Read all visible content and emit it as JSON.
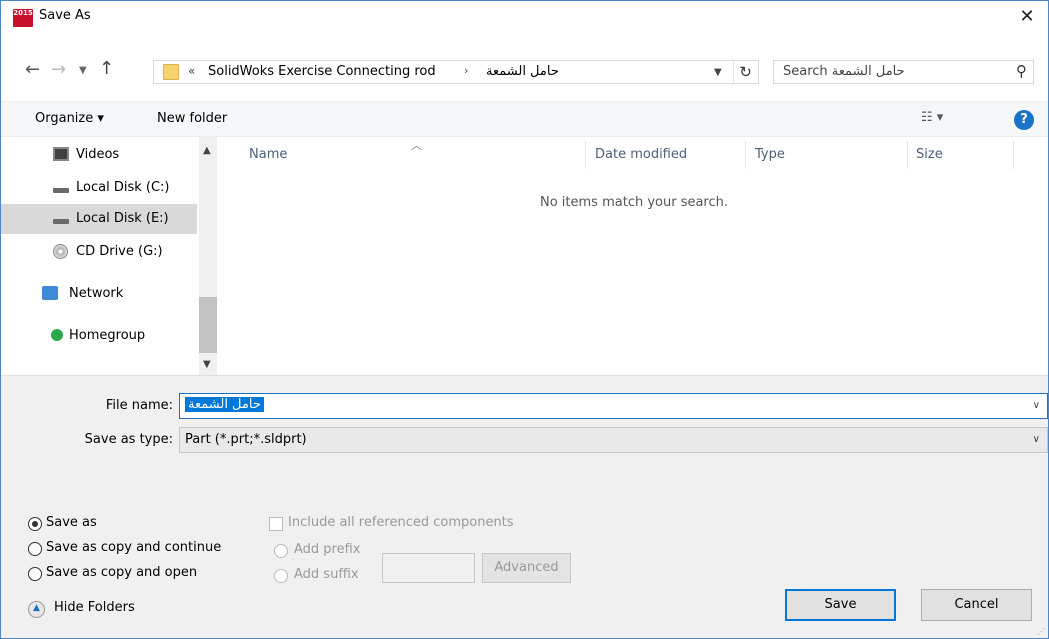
{
  "window": {
    "title": "Save As",
    "app_icon_text": "2015"
  },
  "address": {
    "chevron": "«",
    "crumbs": [
      "SolidWoks Exercise Connecting rod",
      "حامل الشمعة"
    ],
    "separator": "›"
  },
  "search": {
    "placeholder": "Search حامل الشمعة"
  },
  "toolbar": {
    "organize": "Organize ▾",
    "new_folder": "New folder",
    "views": "☷ ▾",
    "help": "?"
  },
  "nav": {
    "items": [
      {
        "label": "Videos",
        "icon": "videos-icon"
      },
      {
        "label": "Local Disk (C:)",
        "icon": "disk-icon"
      },
      {
        "label": "Local Disk (E:)",
        "icon": "disk-icon",
        "selected": true
      },
      {
        "label": "CD Drive (G:)",
        "icon": "cd-icon"
      },
      {
        "label": "Network",
        "icon": "network-icon"
      },
      {
        "label": "Homegroup",
        "icon": "homegroup-icon"
      }
    ]
  },
  "filelist": {
    "columns": [
      "Name",
      "Date modified",
      "Type",
      "Size"
    ],
    "empty_message": "No items match your search."
  },
  "form": {
    "file_name_label": "File name:",
    "file_name_value": "حامل الشمعة",
    "save_type_label": "Save as type:",
    "save_type_value": "Part (*.prt;*.sldprt)"
  },
  "options": {
    "save_as": "Save as",
    "save_copy_continue": "Save as copy and continue",
    "save_copy_open": "Save as copy and open",
    "include_refs": "Include all referenced components",
    "add_prefix": "Add prefix",
    "add_suffix": "Add suffix",
    "advanced": "Advanced"
  },
  "footer": {
    "hide_folders": "Hide Folders",
    "save": "Save",
    "cancel": "Cancel"
  }
}
